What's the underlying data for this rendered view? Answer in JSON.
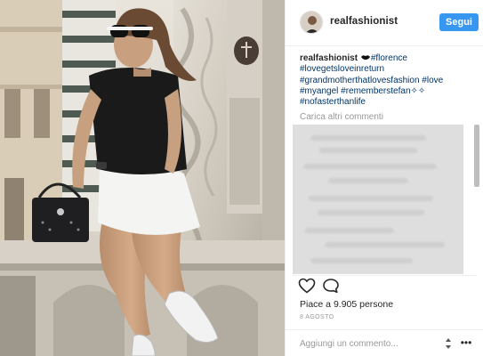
{
  "photo": {
    "alt_subject": "woman-seated-on-marble-ledge",
    "colors": {
      "marble": "#d6d0c6",
      "shirt": "#1a1a1a",
      "skirt": "#f4f4f2",
      "skin": "#c9a07f"
    }
  },
  "header": {
    "username": "realfashionist",
    "follow_label": "Segui",
    "accent": "#3897f0"
  },
  "caption": {
    "username": "realfashionist",
    "lips_icon": "lips-icon",
    "line1_tail": "#florence",
    "line2": "#lovegetsloveinreturn",
    "line3": "#grandmotherthatlovesfashion #love",
    "line4": "#myangel #rememberstefan✧✧",
    "line5": "#nofasterthanlife"
  },
  "load_more": "Carica altri commenti",
  "actions": {
    "like_icon": "heart-icon",
    "comment_icon": "comment-bubble-icon"
  },
  "likes_text": "Piace a 9.905 persone",
  "date": "8 AGOSTO",
  "add_comment": {
    "placeholder": "Aggiungi un commento...",
    "more_icon": "ellipsis-icon"
  }
}
